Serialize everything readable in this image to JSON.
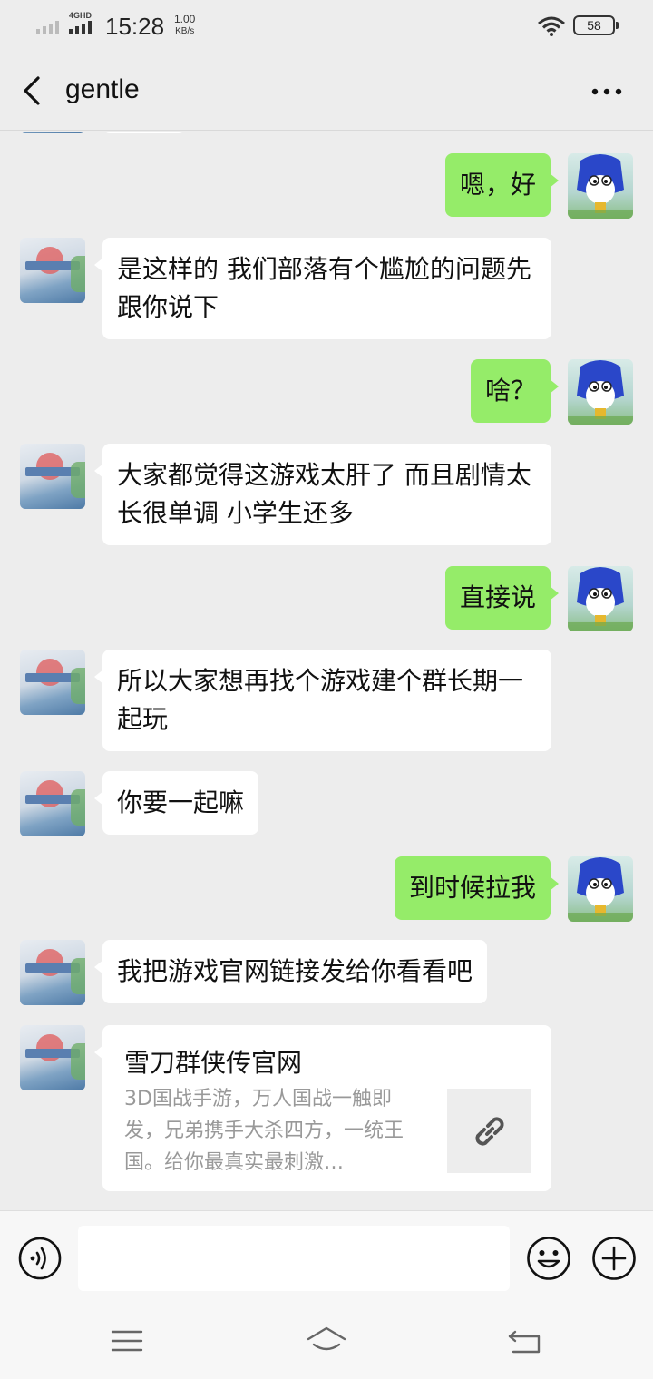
{
  "status_bar": {
    "network_type": "4GHD",
    "time": "15:28",
    "speed_value": "1.00",
    "speed_unit": "KB/s",
    "battery_level": "58"
  },
  "header": {
    "title": "gentle"
  },
  "colors": {
    "background": "#ededed",
    "outgoing_bubble": "#95ec69",
    "incoming_bubble": "#ffffff",
    "muted_text": "#999999"
  },
  "messages": [
    {
      "side": "right",
      "text": "嗯，好"
    },
    {
      "side": "left",
      "text": "是这样的 我们部落有个尴尬的问题先跟你说下"
    },
    {
      "side": "right",
      "text": "啥？"
    },
    {
      "side": "left",
      "text": "大家都觉得这游戏太肝了 而且剧情太长很单调 小学生还多"
    },
    {
      "side": "right",
      "text": "直接说"
    },
    {
      "side": "left",
      "text": "所以大家想再找个游戏建个群长期一起玩"
    },
    {
      "side": "left",
      "text": "你要一起嘛"
    },
    {
      "side": "right",
      "text": "到时候拉我"
    },
    {
      "side": "left",
      "text": "我把游戏官网链接发给你看看吧"
    }
  ],
  "link_card": {
    "title": "雪刀群侠传官网",
    "description": "3D国战手游，万人国战一触即发，兄弟携手大杀四方，一统王国。给你最真实最刺激…",
    "thumb_icon": "link-icon"
  },
  "input_bar": {
    "voice_icon": "voice-icon",
    "emoji_icon": "emoji-icon",
    "plus_icon": "plus-icon",
    "text_value": ""
  },
  "nav_bar": {
    "items": [
      "menu-icon",
      "home-icon",
      "back-icon"
    ]
  }
}
